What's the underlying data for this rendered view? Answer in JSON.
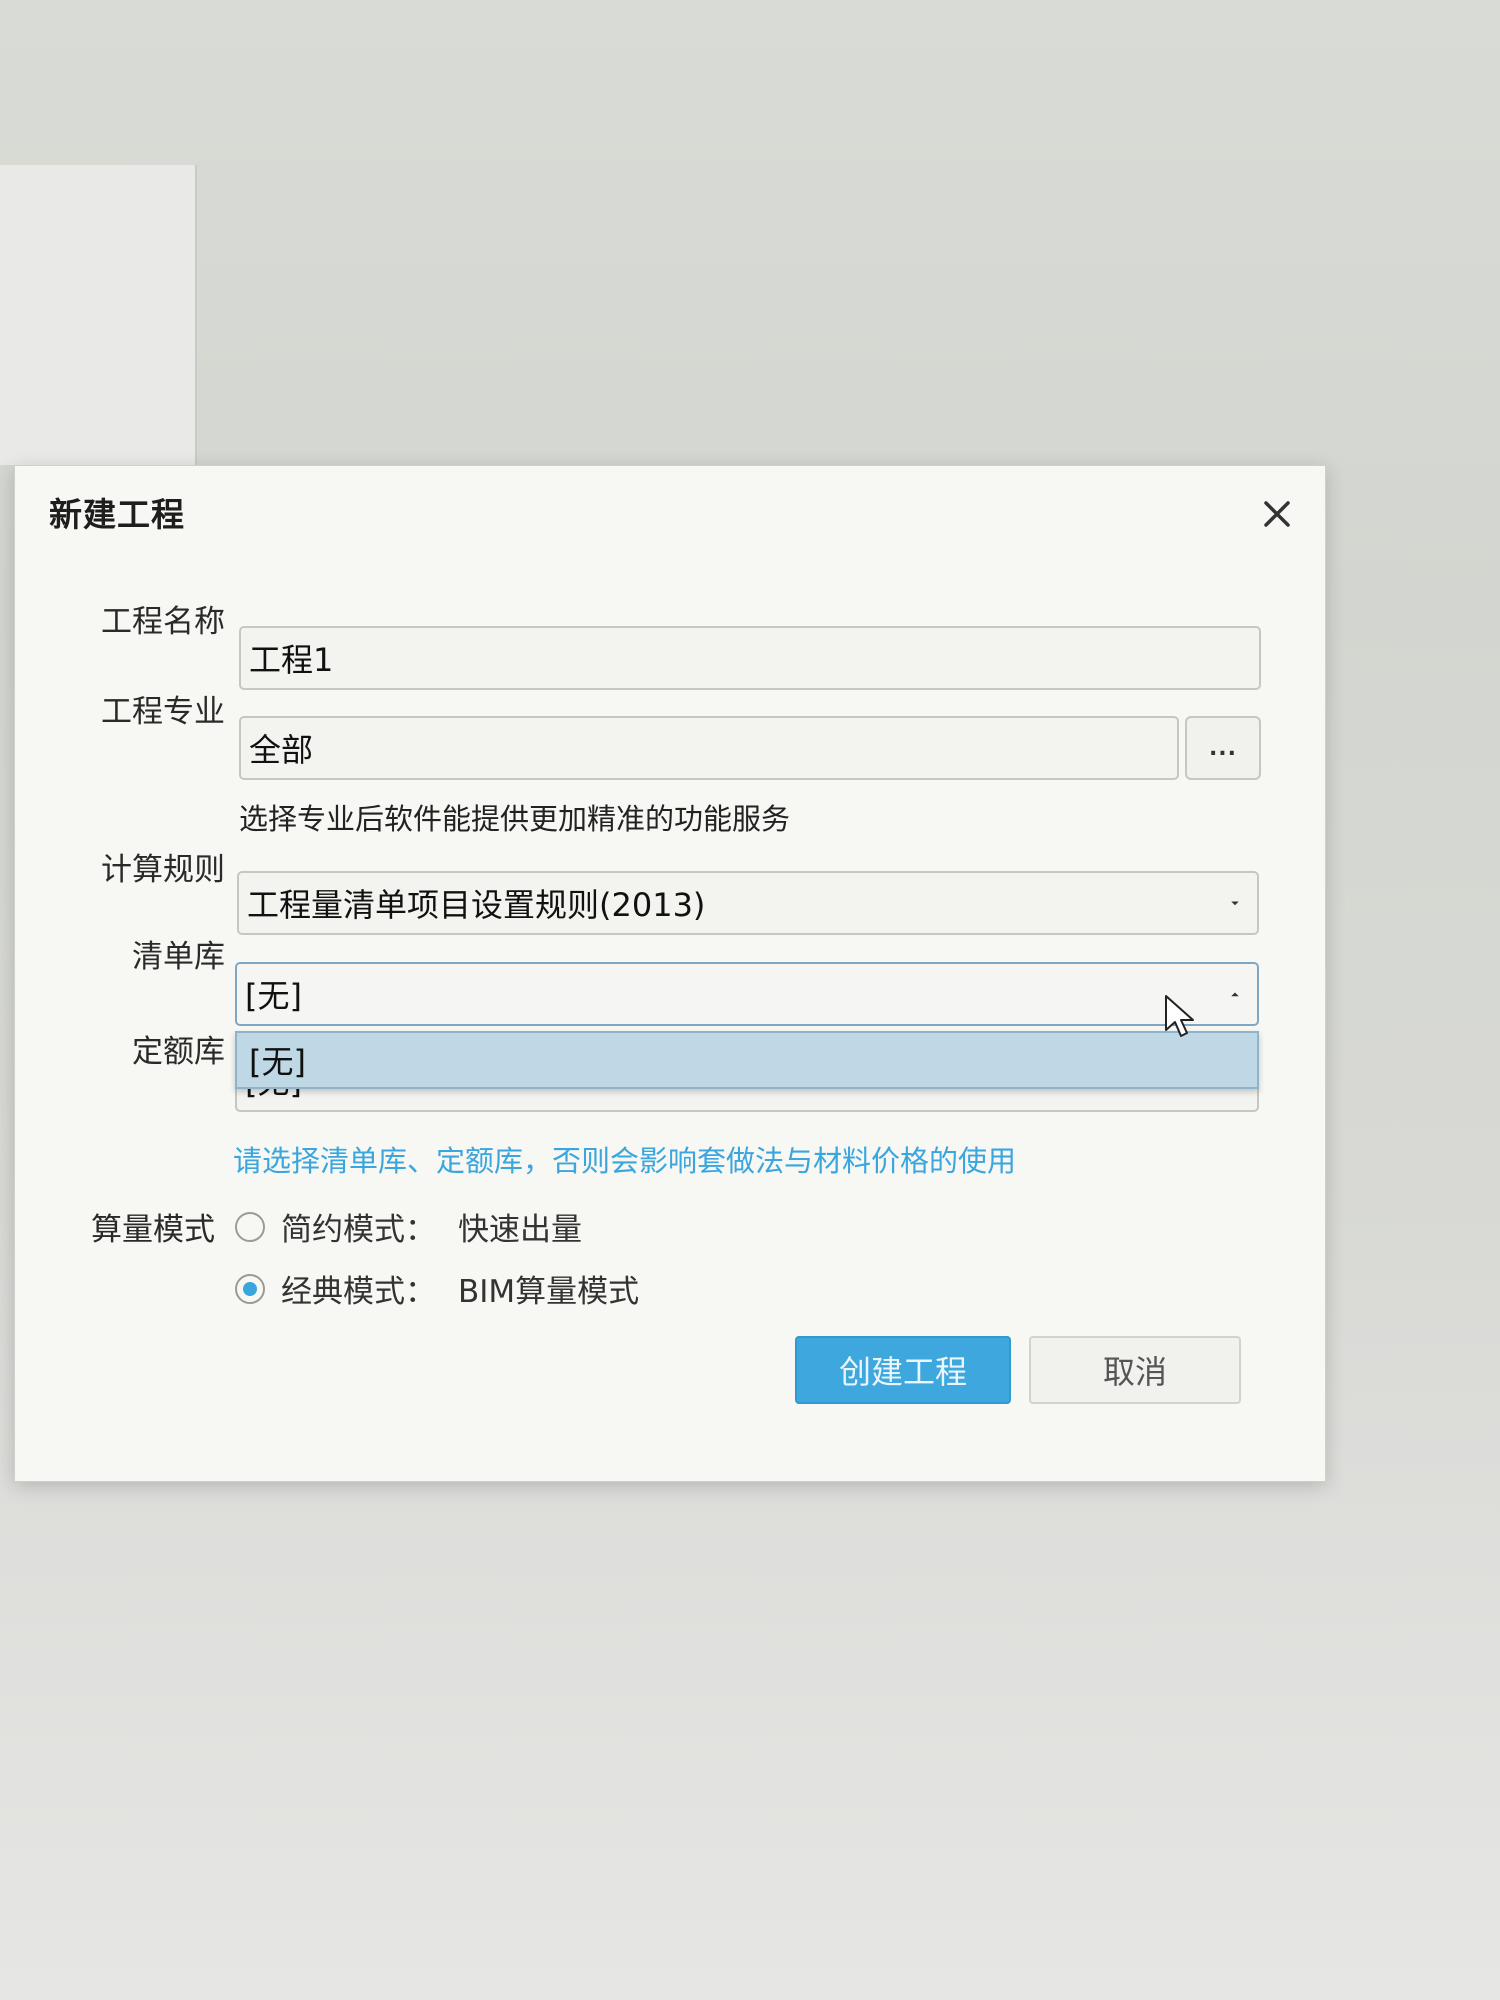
{
  "dialog": {
    "title": "新建工程",
    "close_icon": "close-icon"
  },
  "form": {
    "project_name": {
      "label": "工程名称",
      "value": "工程1"
    },
    "specialty": {
      "label": "工程专业",
      "value": "全部",
      "browse_label": "...",
      "hint": "选择专业后软件能提供更加精准的功能服务"
    },
    "calc_rule": {
      "label": "计算规则",
      "value": "工程量清单项目设置规则(2013)"
    },
    "bill_library": {
      "label": "清单库",
      "value": "[无]",
      "options": [
        "[无]"
      ]
    },
    "quota_library": {
      "label": "定额库",
      "value": "[无]"
    },
    "library_warning": "请选择清单库、定额库，否则会影响套做法与材料价格的使用",
    "mode": {
      "label": "算量模式",
      "options": [
        {
          "name": "简约模式：",
          "desc": "快速出量",
          "selected": false
        },
        {
          "name": "经典模式：",
          "desc": "BIM算量模式",
          "selected": true
        }
      ]
    }
  },
  "buttons": {
    "create": "创建工程",
    "cancel": "取消"
  },
  "colors": {
    "accent": "#3ea7dd",
    "dropdown_highlight": "#bfd8e6",
    "warning_text": "#3aa6dd"
  }
}
